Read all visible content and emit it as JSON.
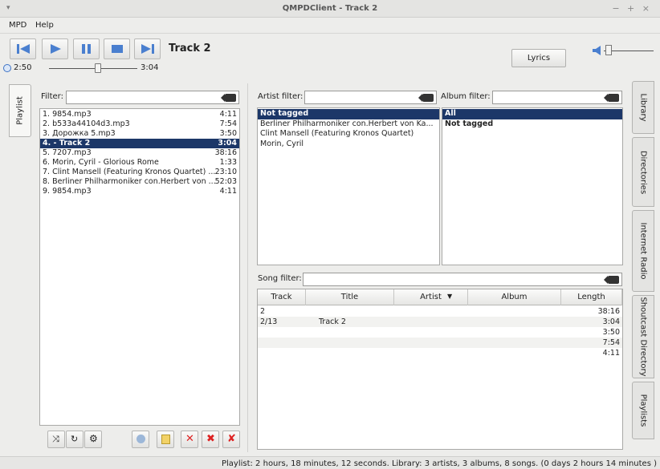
{
  "window": {
    "title": "QMPDClient - Track 2",
    "controls": "− + ×"
  },
  "menu": {
    "mpd": "MPD",
    "help": "Help"
  },
  "player": {
    "track_title": "Track 2",
    "elapsed": "2:50",
    "total": "3:04",
    "lyrics_label": "Lyrics",
    "volume_fraction": 0.1,
    "seek_fraction": 0.55
  },
  "left_tab": {
    "label": "Playlist"
  },
  "playlist": {
    "filter_label": "Filter:",
    "items": [
      {
        "name": "1. 9854.mp3",
        "time": "4:11"
      },
      {
        "name": "2. b533a44104d3.mp3",
        "time": "7:54"
      },
      {
        "name": "3. Дорожка 5.mp3",
        "time": "3:50"
      },
      {
        "name": "4. - Track  2",
        "time": "3:04",
        "selected": true
      },
      {
        "name": "5. 7207.mp3",
        "time": "38:16"
      },
      {
        "name": "6. Morin, Cyril - Glorious Rome",
        "time": "1:33"
      },
      {
        "name": "7. Clint Mansell (Featuring Kronos Quartet) ...",
        "time": "23:10"
      },
      {
        "name": "8. Berliner Philharmoniker con.Herbert von ...",
        "time": "52:03"
      },
      {
        "name": "9. 9854.mp3",
        "time": "4:11"
      }
    ]
  },
  "library": {
    "artist_filter_label": "Artist filter:",
    "album_filter_label": "Album filter:",
    "song_filter_label": "Song filter:",
    "artists": [
      "Not tagged",
      "Berliner Philharmoniker con.Herbert von Ka...",
      "Clint Mansell (Featuring Kronos Quartet)",
      "Morin, Cyril"
    ],
    "albums": [
      "All",
      "Not tagged"
    ],
    "columns": [
      "Track",
      "Title",
      "Artist",
      "Album",
      "Length"
    ],
    "songs": [
      {
        "track": "2",
        "title": "",
        "artist": "",
        "album": "",
        "length": "38:16"
      },
      {
        "track": "2/13",
        "title": "Track  2",
        "artist": "",
        "album": "",
        "length": "3:04"
      },
      {
        "track": "",
        "title": "",
        "artist": "",
        "album": "",
        "length": "3:50"
      },
      {
        "track": "",
        "title": "",
        "artist": "",
        "album": "",
        "length": "7:54"
      },
      {
        "track": "",
        "title": "",
        "artist": "",
        "album": "",
        "length": "4:11"
      }
    ]
  },
  "right_tabs": [
    "Library",
    "Directories",
    "Internet Radio",
    "Shoutcast Directory",
    "Playlists"
  ],
  "status": "Playlist: 2 hours, 18 minutes, 12 seconds.  Library: 3 artists, 3 albums, 8 songs. (0 days 2 hours 14 minutes )",
  "colors": {
    "selection": "#1c3768",
    "transport_icon": "#4a7fcf"
  }
}
